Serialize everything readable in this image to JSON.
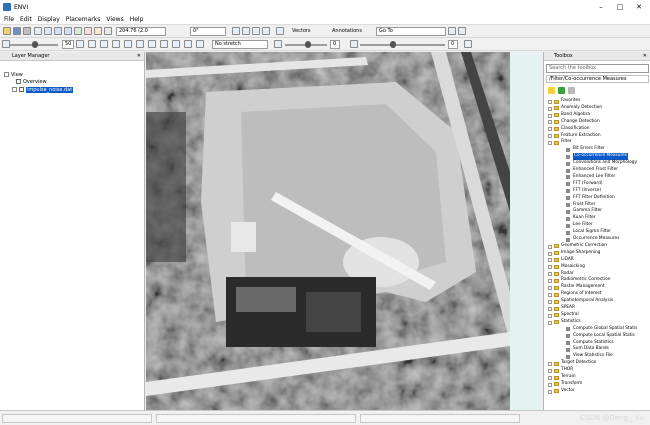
{
  "window": {
    "title": "ENVI"
  },
  "menu": [
    "File",
    "Edit",
    "Display",
    "Placemarks",
    "Views",
    "Help"
  ],
  "toolbar1": {
    "coordinate": "204.76 (2.0",
    "rotation": "0°",
    "vectors_label": "Vectors",
    "annotations_label": "Annotations",
    "goto_label": "Go To"
  },
  "toolbar2": {
    "zoom_value": "50",
    "stretch_value": "No stretch",
    "brightness_value": "0",
    "contrast_value": "0"
  },
  "layer_manager": {
    "title": "Layer Manager",
    "root": "View",
    "items": [
      "Overview",
      "impulse_noise.dat"
    ]
  },
  "toolbox": {
    "title": "Toolbox",
    "search_placeholder": "Search the toolbox",
    "path": "/Filter/Co-occurrence Measures",
    "rows": [
      {
        "label": "Favorites",
        "kind": "folder",
        "depth": 0,
        "expanded": false
      },
      {
        "label": "Anomaly Detection",
        "kind": "folder",
        "depth": 0,
        "expanded": false
      },
      {
        "label": "Band Algebra",
        "kind": "folder",
        "depth": 0,
        "expanded": false
      },
      {
        "label": "Change Detection",
        "kind": "folder",
        "depth": 0,
        "expanded": false
      },
      {
        "label": "Classification",
        "kind": "folder",
        "depth": 0,
        "expanded": false
      },
      {
        "label": "Feature Extraction",
        "kind": "folder",
        "depth": 0,
        "expanded": false
      },
      {
        "label": "Filter",
        "kind": "folder",
        "depth": 0,
        "expanded": true
      },
      {
        "label": "Bit Errors Filter",
        "kind": "tool",
        "depth": 1
      },
      {
        "label": "Co-occurrence Measures",
        "kind": "tool",
        "depth": 1,
        "selected": true
      },
      {
        "label": "Convolutions and Morphology",
        "kind": "tool",
        "depth": 1
      },
      {
        "label": "Enhanced Frost Filter",
        "kind": "tool",
        "depth": 1
      },
      {
        "label": "Enhanced Lee Filter",
        "kind": "tool",
        "depth": 1
      },
      {
        "label": "FFT (Forward)",
        "kind": "tool",
        "depth": 1
      },
      {
        "label": "FFT (Inverse)",
        "kind": "tool",
        "depth": 1
      },
      {
        "label": "FFT Filter Definition",
        "kind": "tool",
        "depth": 1
      },
      {
        "label": "Frost Filter",
        "kind": "tool",
        "depth": 1
      },
      {
        "label": "Gamma Filter",
        "kind": "tool",
        "depth": 1
      },
      {
        "label": "Kuan Filter",
        "kind": "tool",
        "depth": 1
      },
      {
        "label": "Lee Filter",
        "kind": "tool",
        "depth": 1
      },
      {
        "label": "Local Sigma Filter",
        "kind": "tool",
        "depth": 1
      },
      {
        "label": "Occurrence Measures",
        "kind": "tool",
        "depth": 1
      },
      {
        "label": "Geometric Correction",
        "kind": "folder",
        "depth": 0,
        "expanded": false
      },
      {
        "label": "Image Sharpening",
        "kind": "folder",
        "depth": 0,
        "expanded": false
      },
      {
        "label": "LiDAR",
        "kind": "folder",
        "depth": 0,
        "expanded": false
      },
      {
        "label": "Mosaicking",
        "kind": "folder",
        "depth": 0,
        "expanded": false
      },
      {
        "label": "Radar",
        "kind": "folder",
        "depth": 0,
        "expanded": false
      },
      {
        "label": "Radiometric Correction",
        "kind": "folder",
        "depth": 0,
        "expanded": false
      },
      {
        "label": "Raster Management",
        "kind": "folder",
        "depth": 0,
        "expanded": false
      },
      {
        "label": "Regions of Interest",
        "kind": "folder",
        "depth": 0,
        "expanded": false
      },
      {
        "label": "Spatiotemporal Analysis",
        "kind": "folder",
        "depth": 0,
        "expanded": false
      },
      {
        "label": "SPEAR",
        "kind": "folder",
        "depth": 0,
        "expanded": false
      },
      {
        "label": "Spectral",
        "kind": "folder",
        "depth": 0,
        "expanded": false
      },
      {
        "label": "Statistics",
        "kind": "folder",
        "depth": 0,
        "expanded": true
      },
      {
        "label": "Compute Global Spatial Statis",
        "kind": "tool",
        "depth": 1
      },
      {
        "label": "Compute Local Spatial Statis",
        "kind": "tool",
        "depth": 1
      },
      {
        "label": "Compute Statistics",
        "kind": "tool",
        "depth": 1
      },
      {
        "label": "Sum Data Bands",
        "kind": "tool",
        "depth": 1
      },
      {
        "label": "View Statistics File",
        "kind": "tool",
        "depth": 1
      },
      {
        "label": "Target Detection",
        "kind": "folder",
        "depth": 0,
        "expanded": false
      },
      {
        "label": "THOR",
        "kind": "folder",
        "depth": 0,
        "expanded": false
      },
      {
        "label": "Terrain",
        "kind": "folder",
        "depth": 0,
        "expanded": false
      },
      {
        "label": "Transform",
        "kind": "folder",
        "depth": 0,
        "expanded": false
      },
      {
        "label": "Vector",
        "kind": "folder",
        "depth": 0,
        "expanded": false
      }
    ]
  },
  "status": {
    "watermark": "CSDN @Deng__Xu"
  },
  "colors": {
    "selection": "#0a59c7",
    "folder": "#e8c35c",
    "view_background": "#e4f2f1"
  },
  "icons": [
    "envi-logo",
    "minimize-icon",
    "maximize-icon",
    "close-icon",
    "open-icon",
    "save-icon",
    "zoom-in-icon",
    "zoom-out-icon",
    "pan-icon",
    "rotate-icon",
    "folder-icon",
    "tool-icon"
  ]
}
